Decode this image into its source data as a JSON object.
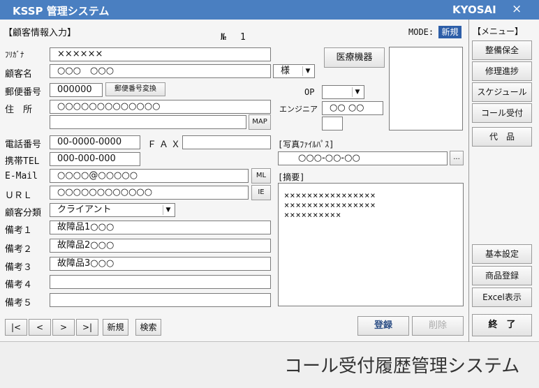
{
  "titlebar": {
    "title": "KSSP 管理システム",
    "right": "KYOSAI",
    "close": "×"
  },
  "header": {
    "section": "【顧客情報入力】",
    "no_label": "№",
    "no_value": "1",
    "mode_label": "MODE:",
    "mode_value": "新規"
  },
  "labels": {
    "furigana": "ﾌﾘｶﾞﾅ",
    "name": "顧客名",
    "postal": "郵便番号",
    "address": "住　所",
    "tel": "電話番号",
    "fax": "ＦＡＸ",
    "mobile": "携帯TEL",
    "email": "E-Mail",
    "url": "ＵＲＬ",
    "category": "顧客分類",
    "note1": "備考１",
    "note2": "備考２",
    "note3": "備考３",
    "note4": "備考４",
    "note5": "備考５",
    "op": "OP",
    "engineer": "エンジニア",
    "photo_path": "[写真ﾌｧｲﾙﾊﾟｽ]",
    "summary": "[摘要]"
  },
  "fields": {
    "furigana": "××××××",
    "name": "○○○　○○○",
    "honorific": "様",
    "postal": "000000",
    "address1": "○○○○○○○○○○○○○",
    "address2": "",
    "tel": "00-0000-0000",
    "fax": "",
    "mobile": "000-000-000",
    "email": "○○○○@○○○○○",
    "url": "○○○○○○○○○○○○",
    "category": "クライアント",
    "note1": "故障品1○○○",
    "note2": "故障品2○○○",
    "note3": "故障品3○○○",
    "note4": "",
    "note5": "",
    "op": "",
    "engineer": "○○ ○○",
    "photo_path": "○○○-○○-○○",
    "summary": [
      "××××××××××××××××",
      "××××××××××××××××",
      "××××××××××"
    ]
  },
  "buttons": {
    "postal_convert": "郵便番号変換",
    "map": "MAP",
    "medical": "医療機器",
    "ml": "ML",
    "ie": "IE",
    "browse": "...",
    "first": "|<",
    "prev": "<",
    "next": ">",
    "last": ">|",
    "new": "新規",
    "search": "検索",
    "register": "登録",
    "delete": "削除"
  },
  "menu": {
    "title": "【メニュー】",
    "items": [
      "整備保全",
      "修理進捗",
      "スケジュール",
      "コール受付",
      "代　品"
    ],
    "lower": [
      "基本設定",
      "商品登録",
      "Excel表示"
    ],
    "exit": "終　了"
  },
  "caption": "コール受付履歴管理システム"
}
